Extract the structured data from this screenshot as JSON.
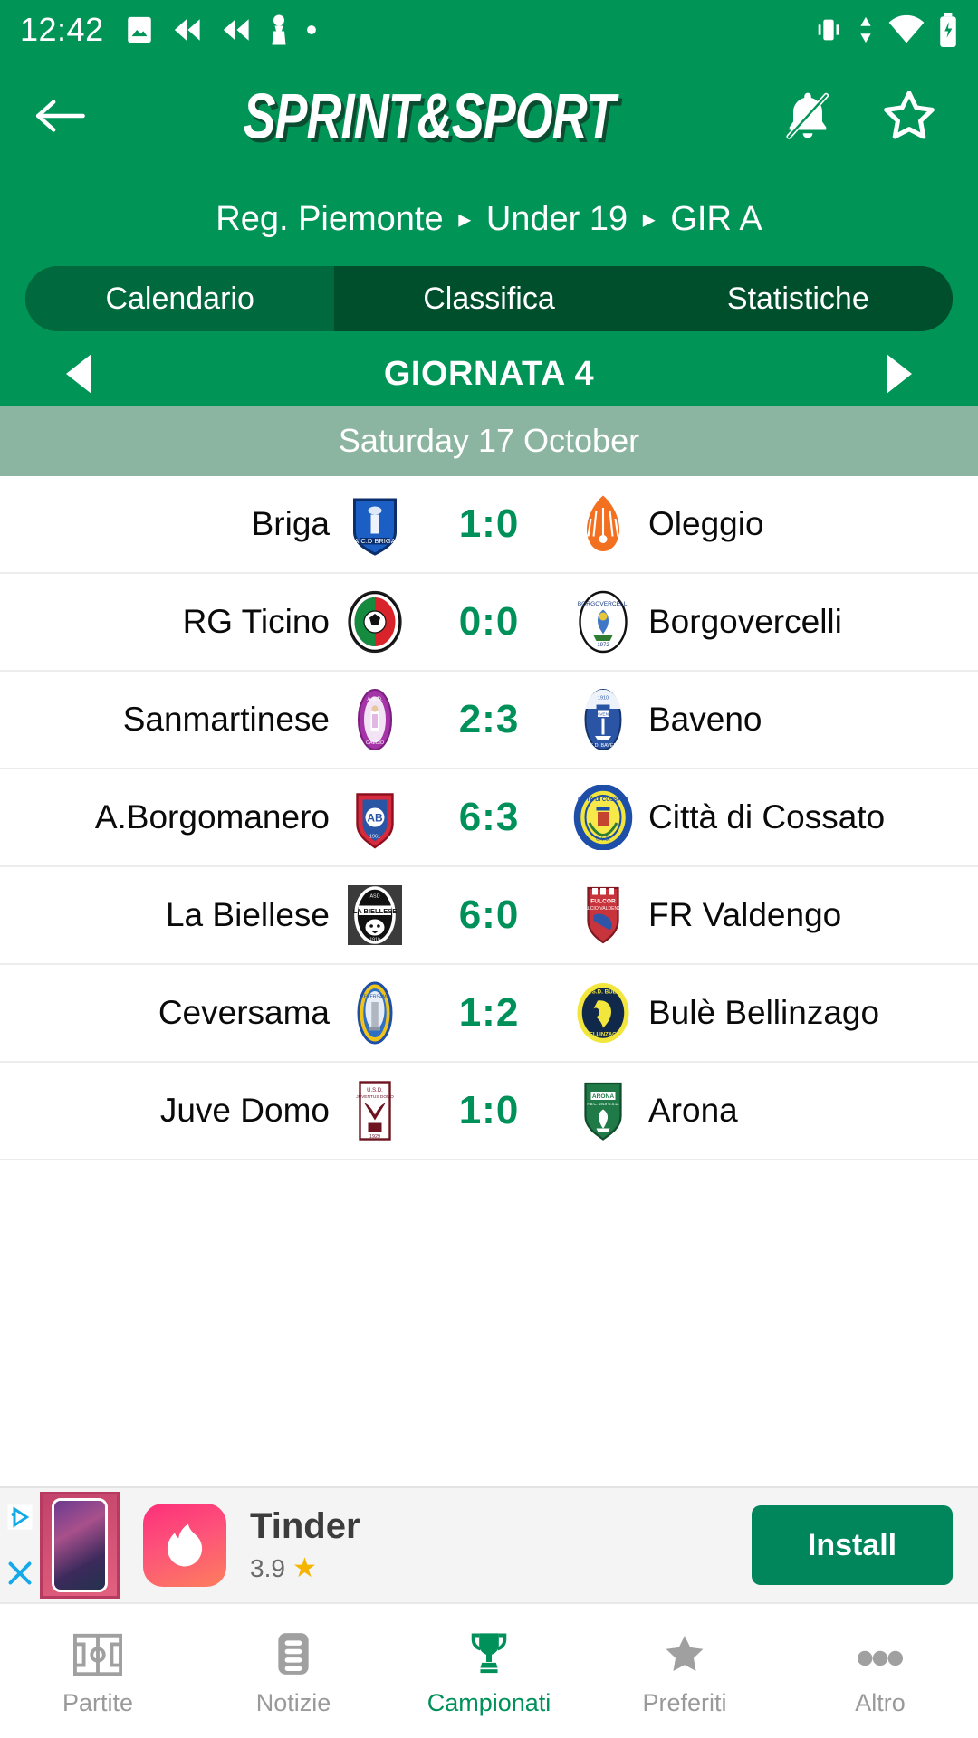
{
  "status_bar": {
    "time": "12:42",
    "left_icons": [
      "image-icon",
      "rewind-icon",
      "rewind-icon",
      "chess-pawn-icon",
      "dot-icon"
    ],
    "right_icons": [
      "vibrate-icon",
      "data-transfer-icon",
      "wifi-icon",
      "battery-charging-icon"
    ]
  },
  "appbar": {
    "back_label": "back-arrow",
    "brand": "SPRINT&SPORT",
    "notifications_label": "bell-off",
    "favorite_label": "star-outline"
  },
  "breadcrumb": {
    "region": "Reg. Piemonte",
    "category": "Under 19",
    "group": "GIR A",
    "separator": "▸"
  },
  "tabs": [
    {
      "label": "Calendario",
      "active": true
    },
    {
      "label": "Classifica",
      "active": false
    },
    {
      "label": "Statistiche",
      "active": false
    }
  ],
  "matchday": {
    "title": "GIORNATA 4",
    "prev_label": "previous-matchday",
    "next_label": "next-matchday"
  },
  "date_header": "Saturday 17 October",
  "matches": [
    {
      "home": "Briga",
      "away": "Oleggio",
      "home_score": "1",
      "away_score": "0",
      "score": "1:0",
      "home_crest": "briga-crest",
      "away_crest": "oleggio-crest"
    },
    {
      "home": "RG Ticino",
      "away": "Borgovercelli",
      "home_score": "0",
      "away_score": "0",
      "score": "0:0",
      "home_crest": "rgticino-crest",
      "away_crest": "borgovercelli-crest"
    },
    {
      "home": "Sanmartinese",
      "away": "Baveno",
      "home_score": "2",
      "away_score": "3",
      "score": "2:3",
      "home_crest": "sanmartinese-crest",
      "away_crest": "baveno-crest"
    },
    {
      "home": "A.Borgomanero",
      "away": "Città di Cossato",
      "home_score": "6",
      "away_score": "3",
      "score": "6:3",
      "home_crest": "borgomanero-crest",
      "away_crest": "cossato-crest"
    },
    {
      "home": "La Biellese",
      "away": "FR Valdengo",
      "home_score": "6",
      "away_score": "0",
      "score": "6:0",
      "home_crest": "biellese-crest",
      "away_crest": "valdengo-crest"
    },
    {
      "home": "Ceversama",
      "away": "Bulè Bellinzago",
      "home_score": "1",
      "away_score": "2",
      "score": "1:2",
      "home_crest": "ceversama-crest",
      "away_crest": "bule-crest"
    },
    {
      "home": "Juve Domo",
      "away": "Arona",
      "home_score": "1",
      "away_score": "0",
      "score": "1:0",
      "home_crest": "juvedomo-crest",
      "away_crest": "arona-crest"
    }
  ],
  "ad": {
    "title": "Tinder",
    "rating": "3.9",
    "star": "★",
    "install_label": "Install",
    "adchoices_label": "ad-choices",
    "close_label": "close-ad"
  },
  "bottom_nav": [
    {
      "label": "Partite",
      "icon": "pitch-icon",
      "active": false
    },
    {
      "label": "Notizie",
      "icon": "news-icon",
      "active": false
    },
    {
      "label": "Campionati",
      "icon": "trophy-icon",
      "active": true
    },
    {
      "label": "Preferiti",
      "icon": "star-icon",
      "active": false
    },
    {
      "label": "Altro",
      "icon": "more-icon",
      "active": false
    }
  ],
  "colors": {
    "brand_green": "#009457",
    "tab_dark": "#004f2c",
    "tab_active": "#00693d",
    "date_band": "#8cb5a1",
    "score_green": "#00915a",
    "install_green": "#00865a",
    "nav_inactive": "#9a9a9a"
  }
}
